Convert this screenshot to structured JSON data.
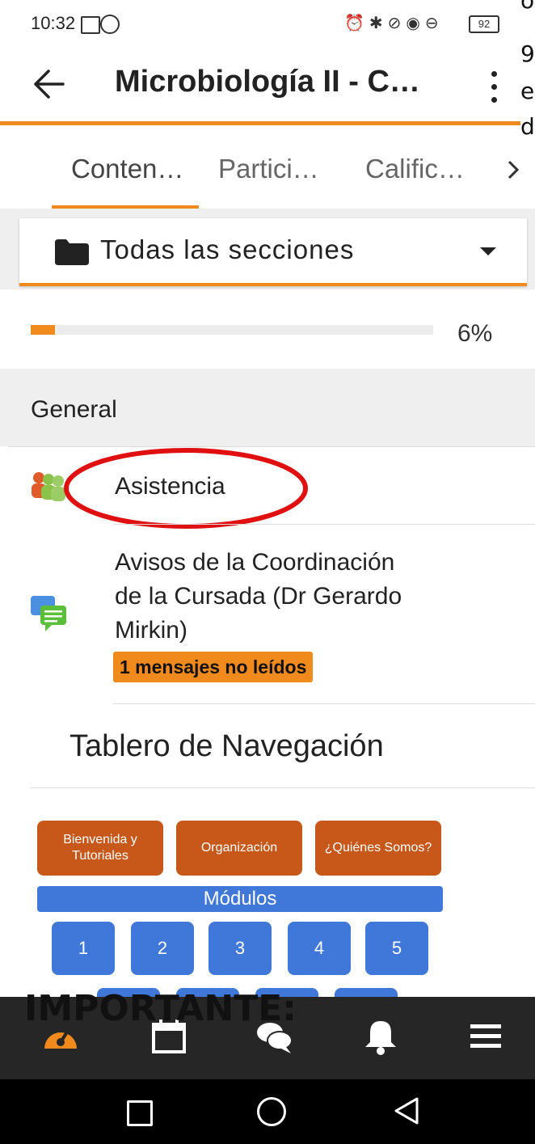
{
  "status_bar": {
    "time": "10:32",
    "battery": "92"
  },
  "edge_overlay": [
    "o",
    "9",
    "e",
    "d"
  ],
  "app_bar": {
    "title": "Microbiología II - C…"
  },
  "tabs": [
    {
      "label": "Conten…",
      "active": true
    },
    {
      "label": "Partici…",
      "active": false
    },
    {
      "label": "Calific…",
      "active": false
    }
  ],
  "section_picker": {
    "label": "Todas las secciones",
    "icon": "folder-icon"
  },
  "progress": {
    "percent_label": "6%",
    "value": 0.06,
    "color": "#f08a1c"
  },
  "general": {
    "label": "General"
  },
  "items": [
    {
      "title": "Asistencia",
      "icon": "attendance-icon"
    },
    {
      "title_lines": [
        "Avisos de la Coordinación",
        "de la Cursada (Dr Gerardo",
        "Mirkin)"
      ],
      "icon": "forum-icon",
      "badge": "1 mensajes no leídos"
    }
  ],
  "nav_heading": "Tablero de Navegación",
  "dashboard": {
    "tiles": [
      "Bienvenida y Tutoriales",
      "Organización",
      "¿Quiénes Somos?"
    ],
    "modules_label": "Módulos",
    "modules": [
      "1",
      "2",
      "3",
      "4",
      "5"
    ]
  },
  "overlay_text": "IMPORTANTE:",
  "bottom_nav": [
    "dashboard-icon",
    "calendar-icon",
    "messages-icon",
    "notifications-icon",
    "menu-icon"
  ],
  "colors": {
    "accent": "#f08a1c",
    "tile_orange": "#c8581a",
    "module_blue": "#3f78d8",
    "annotation_red": "#e01010"
  }
}
